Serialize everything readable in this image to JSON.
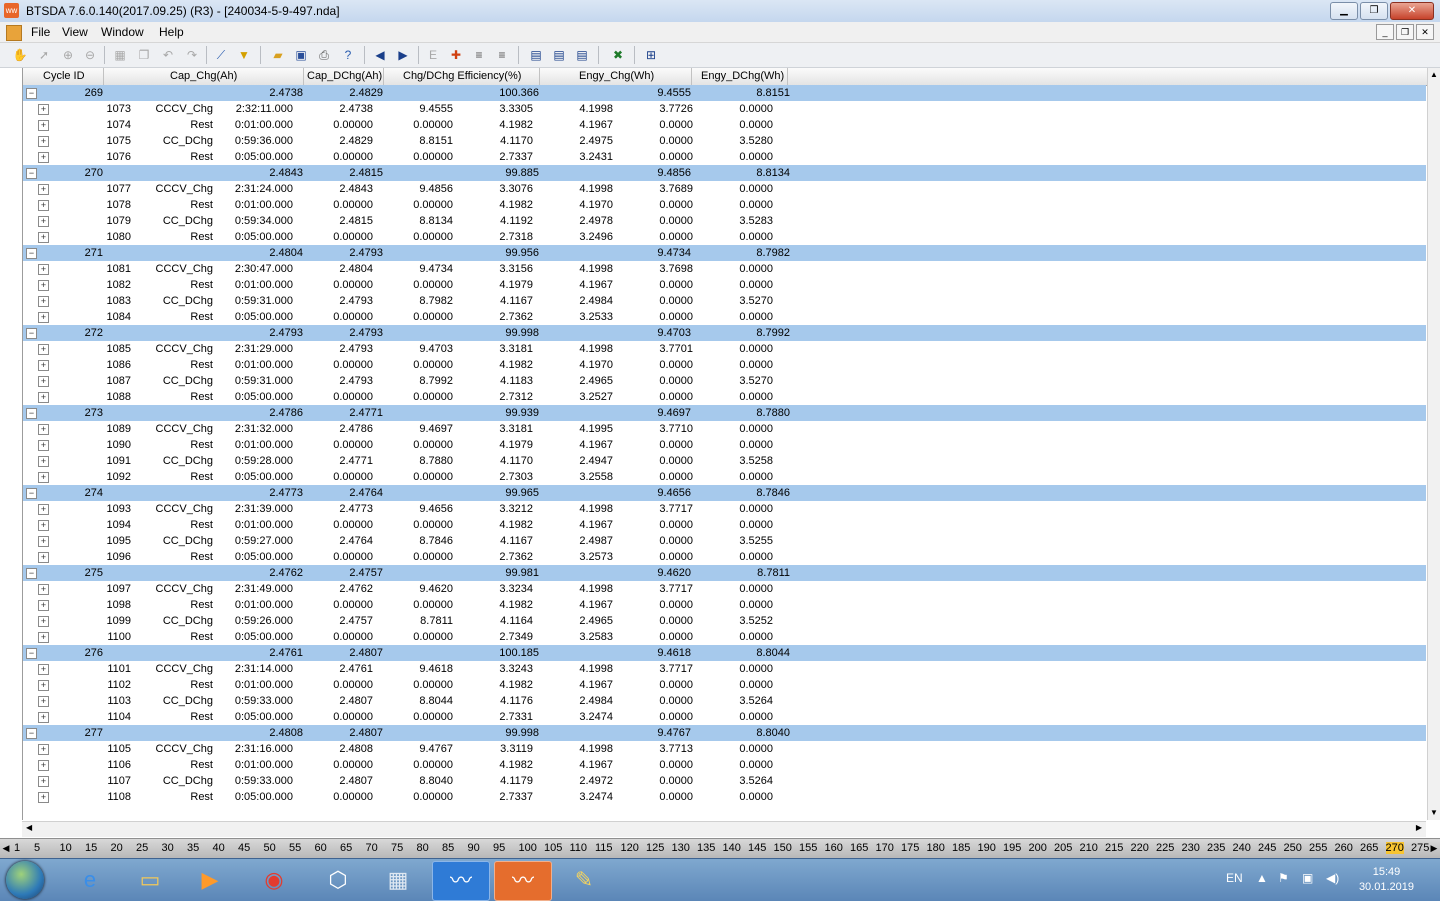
{
  "window": {
    "title": "BTSDA 7.6.0.140(2017.09.25) (R3) - [240034-5-9-497.nda]",
    "min": "▁",
    "max": "❐",
    "close": "✕"
  },
  "menu": {
    "items": [
      "File",
      "View",
      "Window",
      "Help"
    ],
    "mdi_min": "_",
    "mdi_restore": "❐",
    "mdi_close": "✕"
  },
  "toolbar_icons": [
    "hand-icon",
    "pointer-icon",
    "zoom-in-icon",
    "zoom-out-icon",
    "grid-icon",
    "copy-icon",
    "undo-icon",
    "redo-icon",
    "measure-icon",
    "filter-icon",
    "open-icon",
    "save-icon",
    "print-icon",
    "help-icon",
    "back-icon",
    "forward-icon",
    "text-icon",
    "marker-icon",
    "sort-asc-icon",
    "sort-desc-icon",
    "table-icon",
    "table2-icon",
    "table3-icon",
    "excel-icon",
    "export-icon"
  ],
  "columns": [
    "Cycle ID",
    "Cap_Chg(Ah)",
    "Cap_DChg(Ah)",
    "Chg/DChg Efficiency(%)",
    "Engy_Chg(Wh)",
    "Engy_DChg(Wh)"
  ],
  "cycles": [
    {
      "id": "269",
      "cap_chg": "2.4738",
      "cap_dchg": "2.4829",
      "eff": "100.366",
      "engy_chg": "9.4555",
      "engy_dchg": "8.8151",
      "steps": [
        [
          "1073",
          "CCCV_Chg",
          "2:32:11.000",
          "2.4738",
          "9.4555",
          "3.3305",
          "4.1998",
          "3.7726",
          "0.0000"
        ],
        [
          "1074",
          "Rest",
          "0:01:00.000",
          "0.00000",
          "0.00000",
          "4.1982",
          "4.1967",
          "0.0000",
          "0.0000"
        ],
        [
          "1075",
          "CC_DChg",
          "0:59:36.000",
          "2.4829",
          "8.8151",
          "4.1170",
          "2.4975",
          "0.0000",
          "3.5280"
        ],
        [
          "1076",
          "Rest",
          "0:05:00.000",
          "0.00000",
          "0.00000",
          "2.7337",
          "3.2431",
          "0.0000",
          "0.0000"
        ]
      ]
    },
    {
      "id": "270",
      "cap_chg": "2.4843",
      "cap_dchg": "2.4815",
      "eff": "99.885",
      "engy_chg": "9.4856",
      "engy_dchg": "8.8134",
      "steps": [
        [
          "1077",
          "CCCV_Chg",
          "2:31:24.000",
          "2.4843",
          "9.4856",
          "3.3076",
          "4.1998",
          "3.7689",
          "0.0000"
        ],
        [
          "1078",
          "Rest",
          "0:01:00.000",
          "0.00000",
          "0.00000",
          "4.1982",
          "4.1970",
          "0.0000",
          "0.0000"
        ],
        [
          "1079",
          "CC_DChg",
          "0:59:34.000",
          "2.4815",
          "8.8134",
          "4.1192",
          "2.4978",
          "0.0000",
          "3.5283"
        ],
        [
          "1080",
          "Rest",
          "0:05:00.000",
          "0.00000",
          "0.00000",
          "2.7318",
          "3.2496",
          "0.0000",
          "0.0000"
        ]
      ]
    },
    {
      "id": "271",
      "cap_chg": "2.4804",
      "cap_dchg": "2.4793",
      "eff": "99.956",
      "engy_chg": "9.4734",
      "engy_dchg": "8.7982",
      "steps": [
        [
          "1081",
          "CCCV_Chg",
          "2:30:47.000",
          "2.4804",
          "9.4734",
          "3.3156",
          "4.1998",
          "3.7698",
          "0.0000"
        ],
        [
          "1082",
          "Rest",
          "0:01:00.000",
          "0.00000",
          "0.00000",
          "4.1979",
          "4.1967",
          "0.0000",
          "0.0000"
        ],
        [
          "1083",
          "CC_DChg",
          "0:59:31.000",
          "2.4793",
          "8.7982",
          "4.1167",
          "2.4984",
          "0.0000",
          "3.5270"
        ],
        [
          "1084",
          "Rest",
          "0:05:00.000",
          "0.00000",
          "0.00000",
          "2.7362",
          "3.2533",
          "0.0000",
          "0.0000"
        ]
      ]
    },
    {
      "id": "272",
      "cap_chg": "2.4793",
      "cap_dchg": "2.4793",
      "eff": "99.998",
      "engy_chg": "9.4703",
      "engy_dchg": "8.7992",
      "steps": [
        [
          "1085",
          "CCCV_Chg",
          "2:31:29.000",
          "2.4793",
          "9.4703",
          "3.3181",
          "4.1998",
          "3.7701",
          "0.0000"
        ],
        [
          "1086",
          "Rest",
          "0:01:00.000",
          "0.00000",
          "0.00000",
          "4.1982",
          "4.1970",
          "0.0000",
          "0.0000"
        ],
        [
          "1087",
          "CC_DChg",
          "0:59:31.000",
          "2.4793",
          "8.7992",
          "4.1183",
          "2.4965",
          "0.0000",
          "3.5270"
        ],
        [
          "1088",
          "Rest",
          "0:05:00.000",
          "0.00000",
          "0.00000",
          "2.7312",
          "3.2527",
          "0.0000",
          "0.0000"
        ]
      ]
    },
    {
      "id": "273",
      "cap_chg": "2.4786",
      "cap_dchg": "2.4771",
      "eff": "99.939",
      "engy_chg": "9.4697",
      "engy_dchg": "8.7880",
      "steps": [
        [
          "1089",
          "CCCV_Chg",
          "2:31:32.000",
          "2.4786",
          "9.4697",
          "3.3181",
          "4.1995",
          "3.7710",
          "0.0000"
        ],
        [
          "1090",
          "Rest",
          "0:01:00.000",
          "0.00000",
          "0.00000",
          "4.1979",
          "4.1967",
          "0.0000",
          "0.0000"
        ],
        [
          "1091",
          "CC_DChg",
          "0:59:28.000",
          "2.4771",
          "8.7880",
          "4.1170",
          "2.4947",
          "0.0000",
          "3.5258"
        ],
        [
          "1092",
          "Rest",
          "0:05:00.000",
          "0.00000",
          "0.00000",
          "2.7303",
          "3.2558",
          "0.0000",
          "0.0000"
        ]
      ]
    },
    {
      "id": "274",
      "cap_chg": "2.4773",
      "cap_dchg": "2.4764",
      "eff": "99.965",
      "engy_chg": "9.4656",
      "engy_dchg": "8.7846",
      "steps": [
        [
          "1093",
          "CCCV_Chg",
          "2:31:39.000",
          "2.4773",
          "9.4656",
          "3.3212",
          "4.1998",
          "3.7717",
          "0.0000"
        ],
        [
          "1094",
          "Rest",
          "0:01:00.000",
          "0.00000",
          "0.00000",
          "4.1982",
          "4.1967",
          "0.0000",
          "0.0000"
        ],
        [
          "1095",
          "CC_DChg",
          "0:59:27.000",
          "2.4764",
          "8.7846",
          "4.1167",
          "2.4987",
          "0.0000",
          "3.5255"
        ],
        [
          "1096",
          "Rest",
          "0:05:00.000",
          "0.00000",
          "0.00000",
          "2.7362",
          "3.2573",
          "0.0000",
          "0.0000"
        ]
      ]
    },
    {
      "id": "275",
      "cap_chg": "2.4762",
      "cap_dchg": "2.4757",
      "eff": "99.981",
      "engy_chg": "9.4620",
      "engy_dchg": "8.7811",
      "steps": [
        [
          "1097",
          "CCCV_Chg",
          "2:31:49.000",
          "2.4762",
          "9.4620",
          "3.3234",
          "4.1998",
          "3.7717",
          "0.0000"
        ],
        [
          "1098",
          "Rest",
          "0:01:00.000",
          "0.00000",
          "0.00000",
          "4.1982",
          "4.1967",
          "0.0000",
          "0.0000"
        ],
        [
          "1099",
          "CC_DChg",
          "0:59:26.000",
          "2.4757",
          "8.7811",
          "4.1164",
          "2.4965",
          "0.0000",
          "3.5252"
        ],
        [
          "1100",
          "Rest",
          "0:05:00.000",
          "0.00000",
          "0.00000",
          "2.7349",
          "3.2583",
          "0.0000",
          "0.0000"
        ]
      ]
    },
    {
      "id": "276",
      "cap_chg": "2.4761",
      "cap_dchg": "2.4807",
      "eff": "100.185",
      "engy_chg": "9.4618",
      "engy_dchg": "8.8044",
      "steps": [
        [
          "1101",
          "CCCV_Chg",
          "2:31:14.000",
          "2.4761",
          "9.4618",
          "3.3243",
          "4.1998",
          "3.7717",
          "0.0000"
        ],
        [
          "1102",
          "Rest",
          "0:01:00.000",
          "0.00000",
          "0.00000",
          "4.1982",
          "4.1967",
          "0.0000",
          "0.0000"
        ],
        [
          "1103",
          "CC_DChg",
          "0:59:33.000",
          "2.4807",
          "8.8044",
          "4.1176",
          "2.4984",
          "0.0000",
          "3.5264"
        ],
        [
          "1104",
          "Rest",
          "0:05:00.000",
          "0.00000",
          "0.00000",
          "2.7331",
          "3.2474",
          "0.0000",
          "0.0000"
        ]
      ]
    },
    {
      "id": "277",
      "cap_chg": "2.4808",
      "cap_dchg": "2.4807",
      "eff": "99.998",
      "engy_chg": "9.4767",
      "engy_dchg": "8.8040",
      "steps": [
        [
          "1105",
          "CCCV_Chg",
          "2:31:16.000",
          "2.4808",
          "9.4767",
          "3.3119",
          "4.1998",
          "3.7713",
          "0.0000"
        ],
        [
          "1106",
          "Rest",
          "0:01:00.000",
          "0.00000",
          "0.00000",
          "4.1982",
          "4.1967",
          "0.0000",
          "0.0000"
        ],
        [
          "1107",
          "CC_DChg",
          "0:59:33.000",
          "2.4807",
          "8.8040",
          "4.1179",
          "2.4972",
          "0.0000",
          "3.5264"
        ],
        [
          "1108",
          "Rest",
          "0:05:00.000",
          "0.00000",
          "0.00000",
          "2.7337",
          "3.2474",
          "0.0000",
          "0.0000"
        ]
      ]
    }
  ],
  "pager": {
    "pages": [
      "1",
      "5",
      "10",
      "15",
      "20",
      "25",
      "30",
      "35",
      "40",
      "45",
      "50",
      "55",
      "60",
      "65",
      "70",
      "75",
      "80",
      "85",
      "90",
      "95",
      "100",
      "105",
      "110",
      "115",
      "120",
      "125",
      "130",
      "135",
      "140",
      "145",
      "150",
      "155",
      "160",
      "165",
      "170",
      "175",
      "180",
      "185",
      "190",
      "195",
      "200",
      "205",
      "210",
      "215",
      "220",
      "225",
      "230",
      "235",
      "240",
      "245",
      "250",
      "255",
      "260",
      "265",
      "270",
      "275"
    ],
    "selected": "270",
    "prev": "◀",
    "next": "▶"
  },
  "taskbar": {
    "apps": [
      "start-orb",
      "ie-icon",
      "explorer-icon",
      "media-player-icon",
      "chrome-icon",
      "box-icon",
      "calculator-icon",
      "btsda-blue-icon",
      "btsda-orange-icon",
      "paint-icon"
    ],
    "lang": "EN",
    "time": "15:49",
    "date": "30.01.2019"
  },
  "colors": {
    "cycle_row": "#a6c9ec",
    "page_selected": "#f7c431"
  }
}
